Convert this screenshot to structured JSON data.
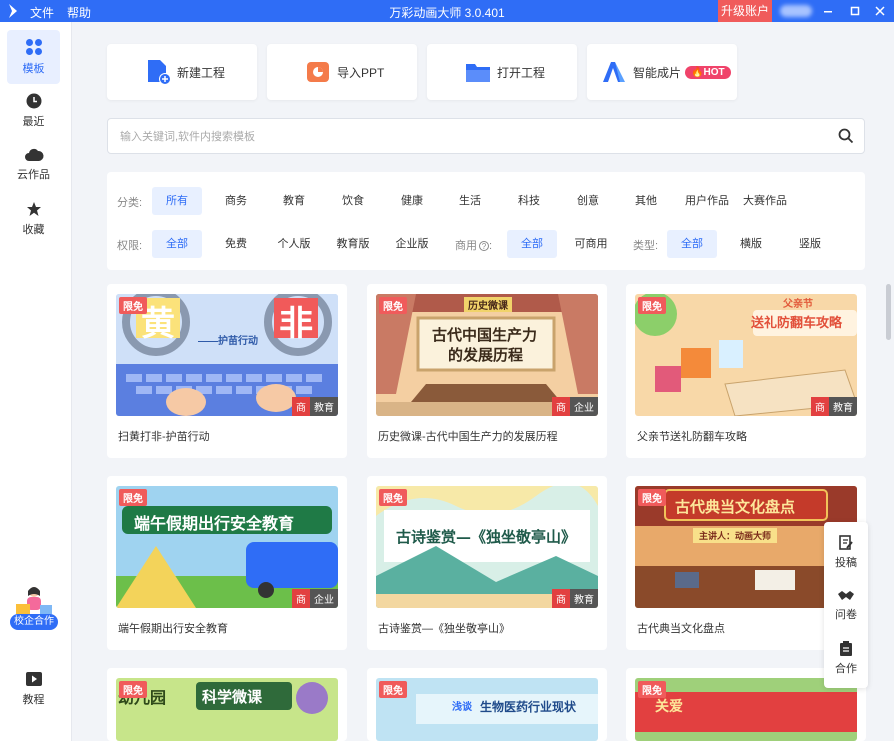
{
  "titlebar": {
    "menu": [
      "文件",
      "帮助"
    ],
    "title": "万彩动画大师 3.0.401",
    "upgrade": "升级账户"
  },
  "sidebar": {
    "items": [
      {
        "label": "模板",
        "icon": "grid-icon",
        "active": true
      },
      {
        "label": "最近",
        "icon": "clock-icon"
      },
      {
        "label": "云作品",
        "icon": "cloud-icon"
      },
      {
        "label": "收藏",
        "icon": "star-icon"
      }
    ],
    "coop_label": "校企合作",
    "tutorial_label": "教程"
  },
  "actions": [
    {
      "label": "新建工程",
      "icon": "new-file-icon"
    },
    {
      "label": "导入PPT",
      "icon": "ppt-icon"
    },
    {
      "label": "打开工程",
      "icon": "folder-icon"
    },
    {
      "label": "智能成片",
      "icon": "ai-icon",
      "badge": "HOT"
    }
  ],
  "search": {
    "placeholder": "输入关键词,软件内搜索模板"
  },
  "filters": {
    "category": {
      "label": "分类:",
      "options": [
        "所有",
        "商务",
        "教育",
        "饮食",
        "健康",
        "生活",
        "科技",
        "创意",
        "其他",
        "用户作品",
        "大赛作品"
      ],
      "selected": "所有"
    },
    "permission": {
      "label": "权限:",
      "options": [
        "全部",
        "免费",
        "个人版",
        "教育版",
        "企业版"
      ],
      "selected": "全部"
    },
    "commercial": {
      "label": "商用",
      "help": "?",
      "colon": ":",
      "options": [
        "全部",
        "可商用"
      ],
      "selected": "全部"
    },
    "type": {
      "label": "类型:",
      "options": [
        "全部",
        "横版",
        "竖版"
      ],
      "selected": "全部"
    }
  },
  "templates": [
    {
      "title": "扫黄打非-护苗行动",
      "badge": "限免",
      "tags": [
        "商",
        "教育"
      ],
      "thumb_text": [
        "黄",
        "非",
        "——护苗行动"
      ],
      "bg": "#bcd4f5"
    },
    {
      "title": "历史微课-古代中国生产力的发展历程",
      "badge": "限免",
      "tags": [
        "商",
        "企业"
      ],
      "thumb_text": [
        "历史微课",
        "古代中国生产力",
        "的发展历程"
      ],
      "bg": "#f4cfa2"
    },
    {
      "title": "父亲节送礼防翻车攻略",
      "badge": "限免",
      "tags": [
        "商",
        "教育"
      ],
      "thumb_text": [
        "父亲节",
        "送礼防翻车攻略"
      ],
      "bg": "#f8d8a8"
    },
    {
      "title": "端午假期出行安全教育",
      "badge": "限免",
      "tags": [
        "商",
        "企业"
      ],
      "thumb_text": [
        "端午假期出行安全教育"
      ],
      "bg": "#9fd3f0"
    },
    {
      "title": "古诗鉴赏—《独坐敬亭山》",
      "badge": "限免",
      "tags": [
        "商",
        "教育"
      ],
      "thumb_text": [
        "古诗鉴赏—《独坐敬亭山》"
      ],
      "bg": "#d8efe7"
    },
    {
      "title": "古代典当文化盘点",
      "badge": "限免",
      "tags": [],
      "thumb_text": [
        "古代典当文化盘点",
        "主讲人：动画大师"
      ],
      "bg": "#e8a96a"
    },
    {
      "title": "",
      "badge": "限免",
      "tags": [],
      "thumb_text": [
        "幼儿园",
        "科学微课"
      ],
      "bg": "#c7e58a"
    },
    {
      "title": "",
      "badge": "限免",
      "tags": [],
      "thumb_text": [
        "浅谈",
        "生物医药行业现状"
      ],
      "bg": "#bfe3f3"
    },
    {
      "title": "",
      "badge": "限免",
      "tags": [],
      "thumb_text": [
        "关爱"
      ],
      "bg": "#9fd07a"
    }
  ],
  "floatbar": [
    {
      "label": "投稿",
      "icon": "edit-icon"
    },
    {
      "label": "问卷",
      "icon": "handshake-icon"
    },
    {
      "label": "合作",
      "icon": "clipboard-icon"
    }
  ],
  "colors": {
    "primary": "#2f6df6",
    "hot": "#f0436a",
    "free_badge": "#f05b5b"
  }
}
